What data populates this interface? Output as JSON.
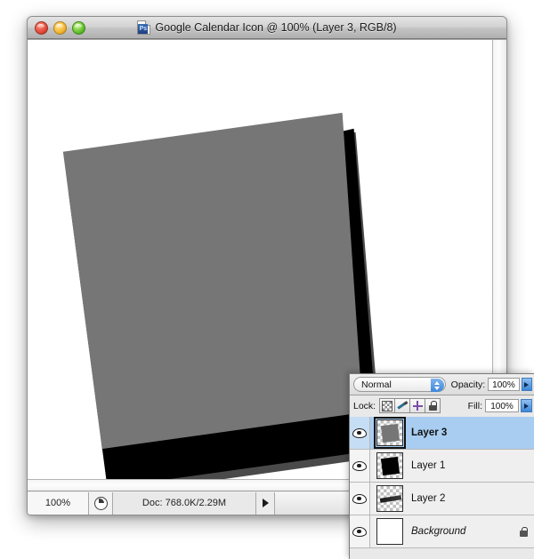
{
  "window": {
    "title": "Google Calendar Icon @ 100% (Layer 3, RGB/8)",
    "app_icon": "photoshop-document-icon",
    "app_badge": "Ps",
    "controls": {
      "close": "close-button",
      "minimize": "minimize-button",
      "zoom": "zoom-button"
    }
  },
  "status_bar": {
    "zoom_level": "100%",
    "pie_icon": "document-sizes-icon",
    "doc_info": "Doc: 768.0K/2.29M",
    "menu_arrow": "status-menu-arrow-icon"
  },
  "layers_panel": {
    "blend_mode": {
      "value": "Normal",
      "stepper_icon": "up-down-stepper-icon"
    },
    "opacity": {
      "label": "Opacity:",
      "value": "100%",
      "arrow_icon": "opacity-slider-arrow-icon"
    },
    "fill": {
      "label": "Fill:",
      "value": "100%",
      "arrow_icon": "fill-slider-arrow-icon"
    },
    "lock": {
      "label": "Lock:",
      "buttons": [
        "lock-transparency-icon",
        "lock-image-pixels-icon",
        "lock-position-icon",
        "lock-all-icon"
      ]
    },
    "layers": [
      {
        "name": "Layer 3",
        "selected": true,
        "visible": true,
        "thumb": "gray-rotated-square",
        "locked": false,
        "italic": false
      },
      {
        "name": "Layer 1",
        "selected": false,
        "visible": true,
        "thumb": "black-rotated-square",
        "locked": false,
        "italic": false
      },
      {
        "name": "Layer 2",
        "selected": false,
        "visible": true,
        "thumb": "dark-diagonal-stroke",
        "locked": false,
        "italic": false
      },
      {
        "name": "Background",
        "selected": false,
        "visible": true,
        "thumb": "white-fill",
        "locked": true,
        "italic": true
      }
    ]
  },
  "canvas": {
    "background_color": "#ffffff",
    "shapes": [
      {
        "name": "black-square-layer-1",
        "color": "#000000"
      },
      {
        "name": "dark-gray-shadow-layer-2",
        "color": "#4a4a4a"
      },
      {
        "name": "gray-square-layer-3",
        "color": "#767676"
      }
    ]
  }
}
